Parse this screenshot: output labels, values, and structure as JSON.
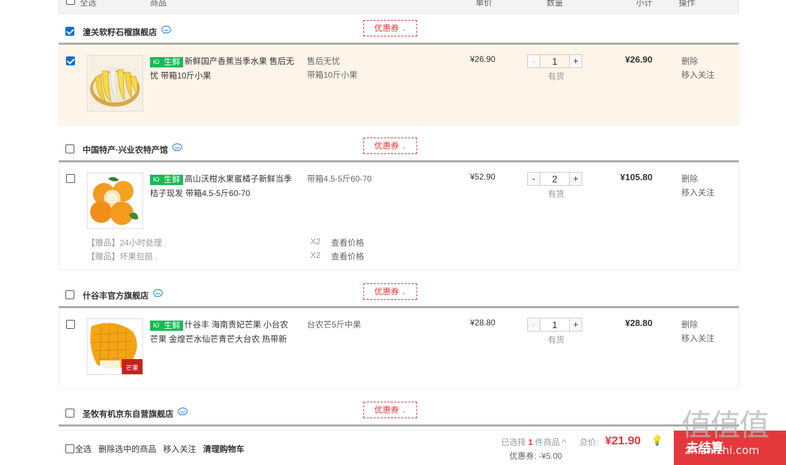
{
  "header": {
    "select_all": "全选",
    "product": "商品",
    "unit_price": "单价",
    "quantity": "数量",
    "subtotal": "小计",
    "operations": "操作"
  },
  "shops": [
    {
      "name": "潼关软籽石榴旗舰店",
      "checked": true,
      "coupon_label": "优惠券",
      "items": [
        {
          "tag": "生鲜",
          "title": "新鲜国产香蕉当季水果 售后无忧 带箱10斤小果",
          "props": [
            "售后无忧",
            "带箱10斤小果"
          ],
          "price": "¥26.90",
          "qty": "1",
          "stock": "有货",
          "subtotal": "¥26.90",
          "ops": [
            "删除",
            "移入关注"
          ]
        }
      ]
    },
    {
      "name": "中国特产·兴业农特产馆",
      "checked": false,
      "coupon_label": "优惠券",
      "items": [
        {
          "tag": "生鲜",
          "title": "高山沃柑水果蜜橘子新鲜当季桔子现发 带箱4.5-5斤60-70",
          "props": [
            "带箱4.5-5斤60-70"
          ],
          "price": "¥52.90",
          "qty": "2",
          "stock": "有货",
          "subtotal": "¥105.80",
          "ops": [
            "删除",
            "移入关注"
          ],
          "gifts": [
            {
              "name": "【赠品】24小时处理 .",
              "count": "X2",
              "link": "查看价格"
            },
            {
              "name": "【赠品】坏果包赔 .",
              "count": "X2",
              "link": "查看价格"
            }
          ]
        }
      ]
    },
    {
      "name": "什谷丰官方旗舰店",
      "checked": false,
      "coupon_label": "优惠券",
      "items": [
        {
          "tag": "生鲜",
          "title": "什谷丰 海南贵妃芒果 小台农芒果 金煌芒水仙芒青芒大台农 热带新",
          "props": [
            "台农芒5斤中果"
          ],
          "price": "¥28.80",
          "qty": "1",
          "stock": "有货",
          "subtotal": "¥28.80",
          "ops": [
            "删除",
            "移入关注"
          ],
          "image_text": "芒果"
        }
      ]
    },
    {
      "name": "圣牧有机京东自营旗舰店",
      "checked": false,
      "coupon_label": "优惠券"
    }
  ],
  "bottom_bar": {
    "select_all": "全选",
    "delete_selected": "删除选中的商品",
    "move_to_follow": "移入关注",
    "clear_cart": "清理购物车",
    "selected_prefix": "已选择",
    "selected_count": "1",
    "selected_suffix": "件商品",
    "total_label": "总价:",
    "total": "¥21.90",
    "coupon_discount": "优惠券: -¥5.00",
    "settle": "去结算"
  },
  "watermark": {
    "big": "值值值",
    "small": "zhizhizhi.com"
  },
  "colors": {
    "accent": "#e4393c",
    "fresh_tag": "#19b955",
    "selected_row": "#fff4e8",
    "checkbox": "#0a6fd8"
  }
}
